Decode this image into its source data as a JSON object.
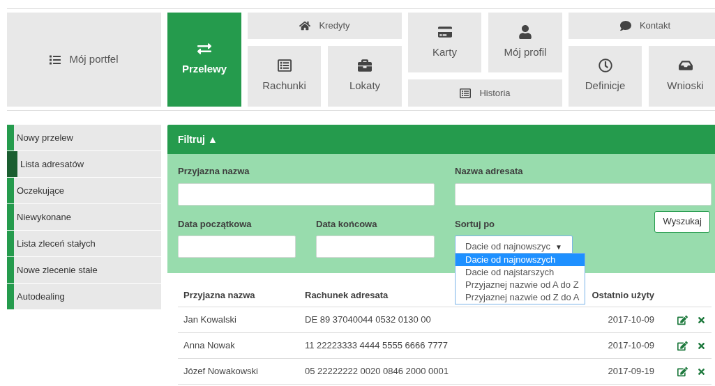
{
  "nav": {
    "tiles": [
      {
        "label": "Mój portfel",
        "selected": false
      },
      {
        "label": "Przelewy",
        "selected": true
      },
      {
        "label": "Kredyty",
        "selected": false
      },
      {
        "label": "Rachunki",
        "selected": false
      },
      {
        "label": "Lokaty",
        "selected": false
      },
      {
        "label": "Karty",
        "selected": false
      },
      {
        "label": "Mój profil",
        "selected": false
      },
      {
        "label": "Historia",
        "selected": false
      },
      {
        "label": "Kontakt",
        "selected": false
      },
      {
        "label": "Definicje",
        "selected": false
      },
      {
        "label": "Wnioski",
        "selected": false
      }
    ]
  },
  "sidebar": {
    "items": [
      {
        "label": "Nowy przelew",
        "selected": false
      },
      {
        "label": "Lista adresatów",
        "selected": true
      },
      {
        "label": "Oczekujące",
        "selected": false
      },
      {
        "label": "Niewykonane",
        "selected": false
      },
      {
        "label": "Lista zleceń stałych",
        "selected": false
      },
      {
        "label": "Nowe zlecenie stałe",
        "selected": false
      },
      {
        "label": "Autodealing",
        "selected": false
      }
    ]
  },
  "filter": {
    "title": "Filtruj",
    "toggle": "▲",
    "expanded": true,
    "friendly_name": {
      "label": "Przyjazna nazwa"
    },
    "recipient_name": {
      "label": "Nazwa adresata"
    },
    "date_from": {
      "label": "Data początkowa"
    },
    "date_to": {
      "label": "Data końcowa"
    },
    "sort": {
      "label": "Sortuj po",
      "value": "Dacie od najnowszyc",
      "caret": "▼",
      "options": [
        {
          "label": "Dacie od najnowszych",
          "selected": true
        },
        {
          "label": "Dacie od najstarszych",
          "selected": false
        },
        {
          "label": "Przyjaznej nazwie od A do Z",
          "selected": false
        },
        {
          "label": "Przyjaznej nazwie od Z do A",
          "selected": false
        }
      ]
    },
    "search_button": "Wyszukaj"
  },
  "table": {
    "columns": [
      "Przyjazna nazwa",
      "Rachunek adresata",
      "Ostatnio użyty"
    ],
    "rows": [
      [
        "Jan Kowalski",
        "DE 89 37040044 0532 0130 00",
        "2017-10-09"
      ],
      [
        "Anna Nowak",
        "11 22223333 4444 5555 6666 7777",
        "2017-10-09"
      ],
      [
        "Józef Nowakowski",
        "05 22222222 0020 0846 2000 0001",
        "2017-09-19"
      ]
    ]
  }
}
